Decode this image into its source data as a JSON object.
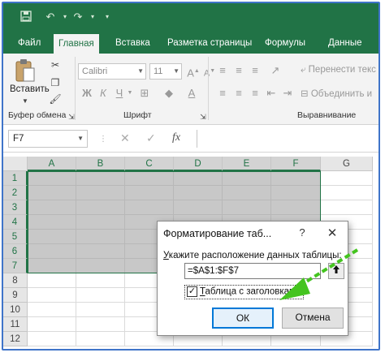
{
  "colors": {
    "excel_green": "#217346",
    "selection_fill": "#c8c8c8",
    "dialog_accent": "#0078d7",
    "annotation_arrow": "#44c41f"
  },
  "quick_access": {
    "icons": [
      "save-icon",
      "undo-icon",
      "redo-icon",
      "customize-icon"
    ]
  },
  "tabs": [
    {
      "label": "Файл"
    },
    {
      "label": "Главная",
      "active": true
    },
    {
      "label": "Вставка"
    },
    {
      "label": "Разметка страницы"
    },
    {
      "label": "Формулы"
    },
    {
      "label": "Данные"
    }
  ],
  "ribbon": {
    "paste_label": "Вставить",
    "clipboard_group": "Буфер обмена",
    "font_group": "Шрифт",
    "alignment_group": "Выравнивание",
    "font_name": "Calibri",
    "font_size": "11",
    "wrap_text": "Перенести текс",
    "merge_center": "Объединить и"
  },
  "formula_bar": {
    "name_box": "F7",
    "cancel_icon": "✕",
    "enter_icon": "✓",
    "fx_label": "fx",
    "formula": ""
  },
  "sheet": {
    "columns": [
      "A",
      "B",
      "C",
      "D",
      "E",
      "F",
      "G"
    ],
    "rows": [
      "1",
      "2",
      "3",
      "4",
      "5",
      "6",
      "7",
      "8",
      "9",
      "10",
      "11",
      "12"
    ],
    "selected_range": "A1:F7"
  },
  "dialog": {
    "title": "Форматирование таб...",
    "help": "?",
    "close": "✕",
    "prompt_underlined": "У",
    "prompt_rest": "кажите расположение данных таблицы:",
    "range_value": "=$A$1:$F$7",
    "collapse_symbol": "🠕",
    "checkbox_mark": "✓",
    "checkbox_checked": true,
    "checkbox_underlined": "Т",
    "checkbox_rest": "аблица с заголовками",
    "ok_label": "ОК",
    "cancel_label": "Отмена"
  }
}
